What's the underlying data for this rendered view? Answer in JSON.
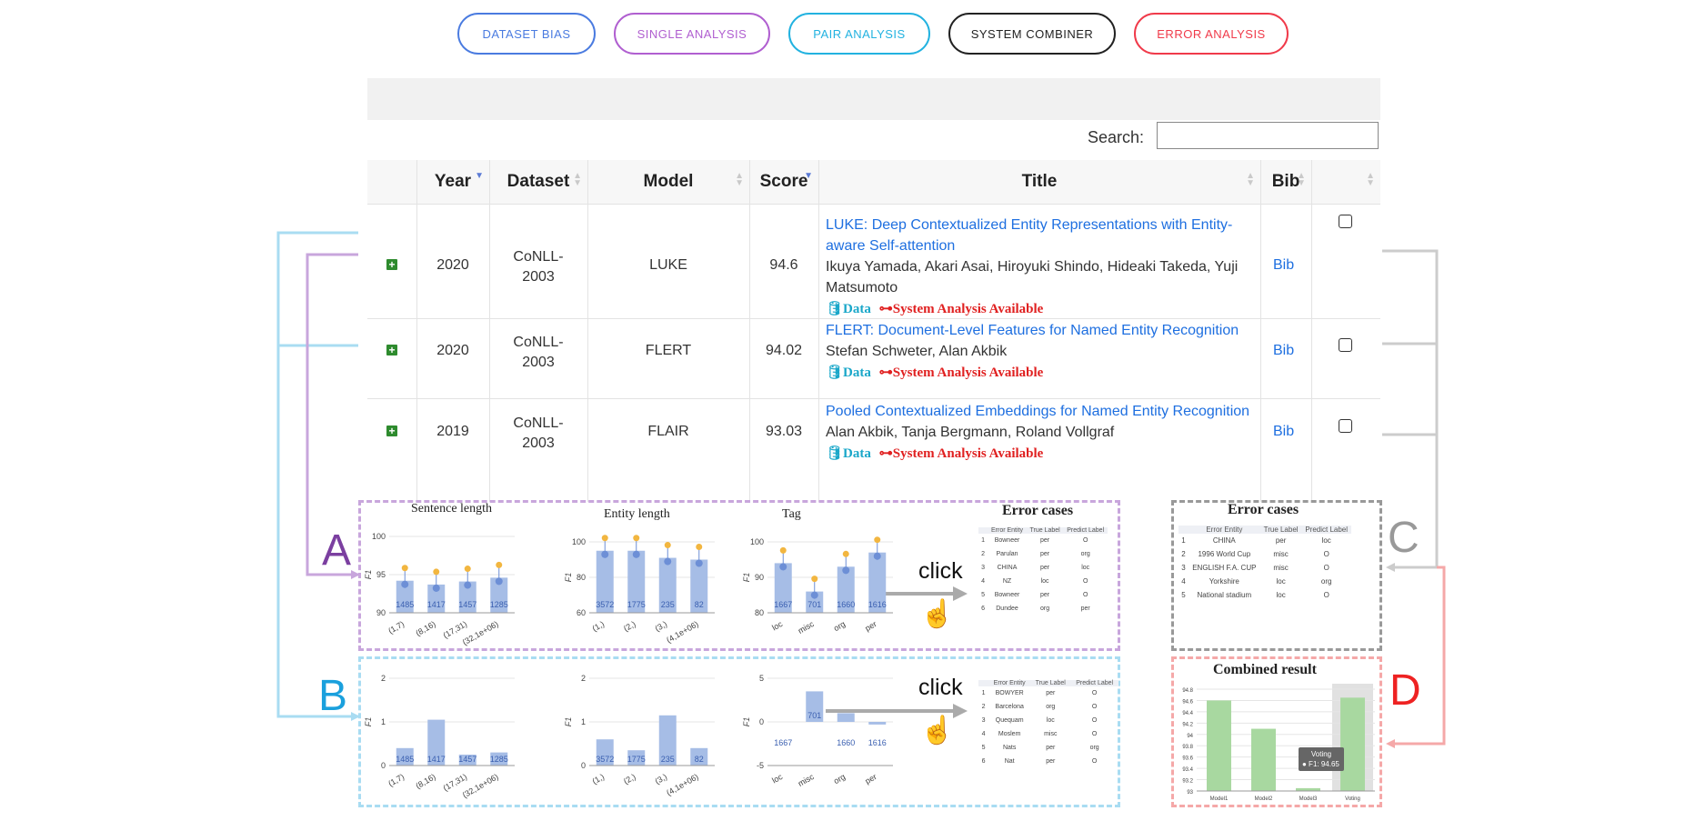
{
  "nav": {
    "buttons": [
      {
        "label": "DATASET BIAS",
        "color": "#4a7be0"
      },
      {
        "label": "SINGLE ANALYSIS",
        "color": "#b05fd0"
      },
      {
        "label": "PAIR ANALYSIS",
        "color": "#22b2e0"
      },
      {
        "label": "SYSTEM COMBINER",
        "color": "#222222"
      },
      {
        "label": "ERROR ANALYSIS",
        "color": "#f03a4a"
      }
    ]
  },
  "search": {
    "label": "Search:",
    "value": ""
  },
  "table": {
    "headers": [
      "Year",
      "Dataset",
      "Model",
      "Score",
      "Title",
      "Bib"
    ],
    "rows": [
      {
        "year": "2020",
        "dataset_line1": "CoNLL-",
        "dataset_line2": "2003",
        "model": "LUKE",
        "score": "94.6",
        "title_line1": "LUKE: Deep Contextualized Entity Representations with Entity-",
        "title_line2": "aware Self-attention",
        "authors_line1": "Ikuya Yamada, Akari Asai, Hiroyuki Shindo, Hideaki Takeda, Yuji",
        "authors_line2": "Matsumoto",
        "data_label": "Data",
        "system_label": "System Analysis Available",
        "bib": "Bib"
      },
      {
        "year": "2020",
        "dataset_line1": "CoNLL-",
        "dataset_line2": "2003",
        "model": "FLERT",
        "score": "94.02",
        "title_line1": "FLERT: Document-Level Features for Named Entity Recognition",
        "authors_line1": "Stefan Schweter, Alan Akbik",
        "data_label": "Data",
        "system_label": "System Analysis Available",
        "bib": "Bib"
      },
      {
        "year": "2019",
        "dataset_line1": "CoNLL-",
        "dataset_line2": "2003",
        "model": "FLAIR",
        "score": "93.03",
        "title_line1": "Pooled Contextualized Embeddings for Named Entity Recognition",
        "authors_line1": "Alan Akbik, Tanja Bergmann, Roland Vollgraf",
        "data_label": "Data",
        "system_label": "System Analysis Available",
        "bib": "Bib"
      }
    ]
  },
  "labels": {
    "A": "A",
    "B": "B",
    "C": "C",
    "D": "D",
    "click": "click"
  },
  "colors": {
    "A": "#7b3fa0",
    "B": "#1aa0dd",
    "C": "#999999",
    "D": "#ee2222"
  },
  "panelA": {
    "titles": [
      "Sentence length",
      "Entity length",
      "Tag",
      "Error cases"
    ]
  },
  "errorA": {
    "headers": [
      "Error Entity",
      "True Label",
      "Predict Label"
    ],
    "rows": [
      [
        "1",
        "Bowneer",
        "per",
        "O"
      ],
      [
        "2",
        "Parulan",
        "per",
        "org"
      ],
      [
        "3",
        "CHINA",
        "per",
        "loc"
      ],
      [
        "4",
        "NZ",
        "loc",
        "O"
      ],
      [
        "5",
        "Bowneer",
        "per",
        "O"
      ],
      [
        "6",
        "Dundee",
        "org",
        "per"
      ]
    ]
  },
  "errorB": {
    "headers": [
      "Error Entity",
      "True Label",
      "Predict Label"
    ],
    "rows": [
      [
        "1",
        "BOWYER",
        "per",
        "O"
      ],
      [
        "2",
        "Barcelona",
        "org",
        "O"
      ],
      [
        "3",
        "Quequam",
        "loc",
        "O"
      ],
      [
        "4",
        "Moslem",
        "misc",
        "O"
      ],
      [
        "5",
        "Nats",
        "per",
        "org"
      ],
      [
        "6",
        "Nat",
        "per",
        "O"
      ]
    ]
  },
  "errorC": {
    "title": "Error cases",
    "headers": [
      "Error Entity",
      "True Label",
      "Predict Label"
    ],
    "rows": [
      [
        "1",
        "CHINA",
        "per",
        "loc"
      ],
      [
        "2",
        "1996 World Cup",
        "misc",
        "O"
      ],
      [
        "3",
        "ENGLISH F.A. CUP",
        "misc",
        "O"
      ],
      [
        "4",
        "Yorkshire",
        "loc",
        "org"
      ],
      [
        "5",
        "National stadium",
        "loc",
        "O"
      ]
    ]
  },
  "combined": {
    "title": "Combined result",
    "tooltip_line1": "Voting",
    "tooltip_line2": "● F1: 94.65"
  },
  "chart_data": [
    {
      "type": "bar",
      "panel": "A",
      "title": "Sentence length",
      "ylabel": "F1",
      "ylim": [
        90,
        100
      ],
      "yticks": [
        "90",
        "95",
        "100"
      ],
      "categories": [
        "(1,7)",
        "(8,16)",
        "(17,31)",
        "(32,1e+06)"
      ],
      "values": [
        94.2,
        93.7,
        94.1,
        94.6
      ],
      "labels": [
        "1485",
        "1417",
        "1457",
        "1285"
      ]
    },
    {
      "type": "bar",
      "panel": "A",
      "title": "Entity length",
      "ylabel": "F1",
      "ylim": [
        60,
        100
      ],
      "yticks": [
        "60",
        "80",
        "100"
      ],
      "categories": [
        "(1,)",
        "(2,)",
        "(3,)",
        "(4,1e+06)"
      ],
      "values": [
        95,
        95,
        91,
        90
      ],
      "labels": [
        "3572",
        "1775",
        "235",
        "82"
      ]
    },
    {
      "type": "bar",
      "panel": "A",
      "title": "Tag",
      "ylabel": "F1",
      "ylim": [
        80,
        100
      ],
      "yticks": [
        "80",
        "90",
        "100"
      ],
      "categories": [
        "loc",
        "misc",
        "org",
        "per"
      ],
      "values": [
        94,
        86,
        93,
        97
      ],
      "labels": [
        "1667",
        "701",
        "1660",
        "1616"
      ]
    },
    {
      "type": "bar",
      "panel": "B",
      "ylabel": "F1",
      "ylim": [
        0,
        2
      ],
      "yticks": [
        "0",
        "1",
        "2"
      ],
      "categories": [
        "(1,7)",
        "(8,16)",
        "(17,31)",
        "(32,1e+06)"
      ],
      "values": [
        0.4,
        1.05,
        0.25,
        0.3
      ],
      "labels": [
        "1485",
        "1417",
        "1457",
        "1285"
      ]
    },
    {
      "type": "bar",
      "panel": "B",
      "ylabel": "F1",
      "ylim": [
        0,
        2
      ],
      "yticks": [
        "0",
        "1",
        "2"
      ],
      "categories": [
        "(1,)",
        "(2,)",
        "(3,)",
        "(4,1e+06)"
      ],
      "values": [
        0.6,
        0.35,
        1.15,
        0.4
      ],
      "labels": [
        "3572",
        "1775",
        "235",
        "82"
      ]
    },
    {
      "type": "bar",
      "panel": "B",
      "ylabel": "F1",
      "ylim": [
        -5,
        5
      ],
      "yticks": [
        "-5",
        "0",
        "5"
      ],
      "categories": [
        "loc",
        "misc",
        "org",
        "per"
      ],
      "values": [
        0,
        3.5,
        1,
        -0.3
      ],
      "labels": [
        "1667",
        "701",
        "1660",
        "1616"
      ]
    },
    {
      "type": "bar",
      "panel": "D",
      "title": "Combined result",
      "ylim": [
        93,
        94.8
      ],
      "yticks": [
        "93",
        "93.2",
        "93.4",
        "93.6",
        "93.8",
        "94",
        "94.2",
        "94.4",
        "94.6",
        "94.8"
      ],
      "categories": [
        "Model1",
        "Model2",
        "Model3",
        "Voting"
      ],
      "values": [
        94.6,
        94.1,
        93.05,
        94.65
      ]
    }
  ]
}
